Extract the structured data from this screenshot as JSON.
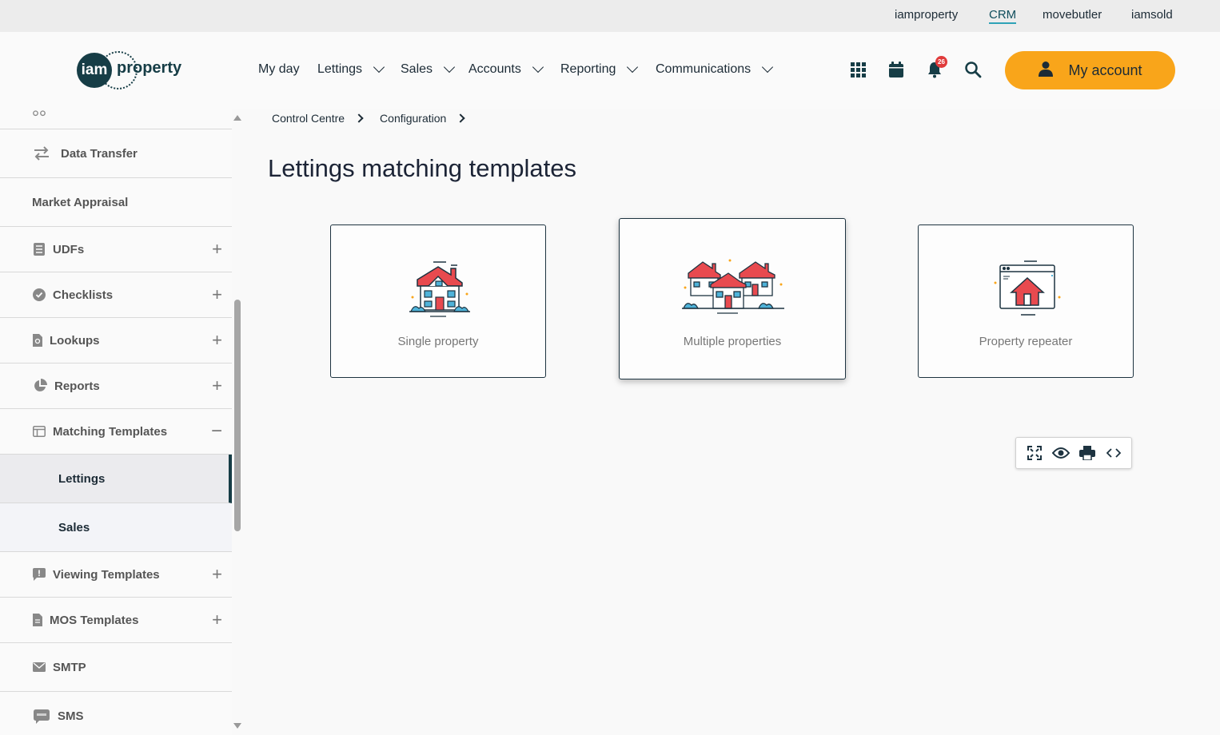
{
  "top_links": [
    {
      "label": "iamproperty"
    },
    {
      "label": "CRM",
      "active": true
    },
    {
      "label": "movebutler"
    },
    {
      "label": "iamsold"
    }
  ],
  "logo": {
    "mark": "iam",
    "text": "property"
  },
  "nav": {
    "my_day": "My day",
    "lettings": "Lettings",
    "sales": "Sales",
    "accounts": "Accounts",
    "reporting": "Reporting",
    "communications": "Communications"
  },
  "header_icons": [
    "apps-grid-icon",
    "calendar-icon",
    "bell-icon",
    "search-icon"
  ],
  "notifications": {
    "count": "26"
  },
  "account": {
    "label": "My account"
  },
  "sidebar": {
    "items": [
      {
        "label": "Data Transfer",
        "icon": "transfer-icon"
      },
      {
        "label": "Market Appraisal"
      },
      {
        "label": "UDFs",
        "icon": "list-icon",
        "expand": "+"
      },
      {
        "label": "Checklists",
        "icon": "check-circle-icon",
        "expand": "+"
      },
      {
        "label": "Lookups",
        "icon": "file-search-icon",
        "expand": "+"
      },
      {
        "label": "Reports",
        "icon": "pie-chart-icon",
        "expand": "+"
      },
      {
        "label": "Matching Templates",
        "icon": "template-icon",
        "expand": "−"
      },
      {
        "label": "Lettings",
        "active": true
      },
      {
        "label": "Sales"
      },
      {
        "label": "Viewing Templates",
        "icon": "comment-alert-icon",
        "expand": "+"
      },
      {
        "label": "MOS Templates",
        "icon": "document-icon",
        "expand": "+"
      },
      {
        "label": "SMTP",
        "icon": "envelope-icon"
      },
      {
        "label": "SMS",
        "icon": "sms-icon"
      }
    ]
  },
  "breadcrumb": {
    "items": [
      "Control Centre",
      "Configuration"
    ]
  },
  "page": {
    "title": "Lettings matching templates"
  },
  "cards": [
    {
      "label": "Single property",
      "icon": "single-house-icon"
    },
    {
      "label": "Multiple properties",
      "icon": "multiple-houses-icon"
    },
    {
      "label": "Property repeater",
      "icon": "browser-house-icon"
    }
  ],
  "toolbar": {
    "icons": [
      "fullscreen-icon",
      "eye-icon",
      "print-icon",
      "code-icon"
    ]
  },
  "colors": {
    "accent": "#f9a51a",
    "brand_dark": "#163d46",
    "house_red": "#e84a4f",
    "house_blue": "#4fb3d9"
  }
}
